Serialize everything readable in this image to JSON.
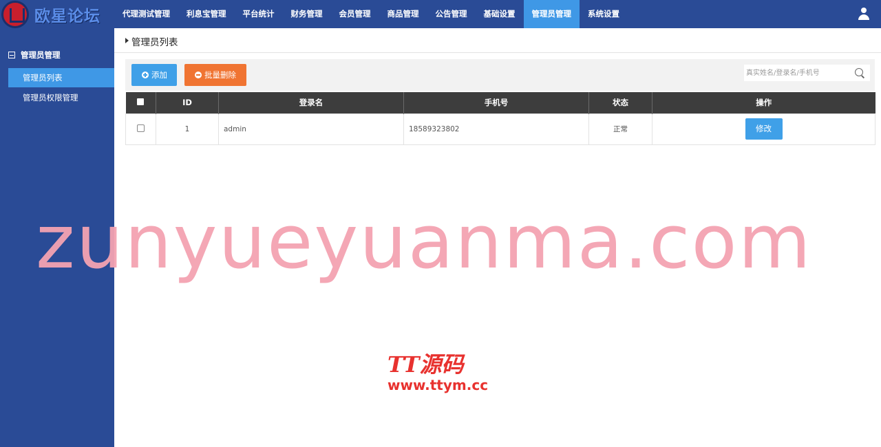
{
  "header": {
    "logo_text": "欧星论坛",
    "nav": [
      "代理测试管理",
      "利息宝管理",
      "平台统计",
      "财务管理",
      "会员管理",
      "商品管理",
      "公告管理",
      "基础设置",
      "管理员管理",
      "系统设置"
    ],
    "active_nav": "管理员管理"
  },
  "sidebar": {
    "group_label": "管理员管理",
    "items": [
      {
        "label": "管理员列表",
        "active": true
      },
      {
        "label": "管理员权限管理",
        "active": false
      }
    ]
  },
  "page": {
    "title": "管理员列表"
  },
  "toolbar": {
    "add_label": "添加",
    "batch_delete_label": "批量删除",
    "search_placeholder": "真实姓名/登录名/手机号"
  },
  "table": {
    "columns": [
      "ID",
      "登录名",
      "手机号",
      "状态",
      "操作"
    ],
    "rows": [
      {
        "id": "1",
        "login": "admin",
        "phone": "18589323802",
        "status": "正常",
        "action": "修改"
      }
    ]
  },
  "watermarks": {
    "main": "zunyueyuanma.com",
    "brand": "TT源码",
    "brand_url": "www.ttym.cc"
  },
  "colors": {
    "nav_bg": "#2a4b96",
    "active_blue": "#3f98e6",
    "delete_orange": "#f07432",
    "table_header": "#3d3d3d"
  }
}
